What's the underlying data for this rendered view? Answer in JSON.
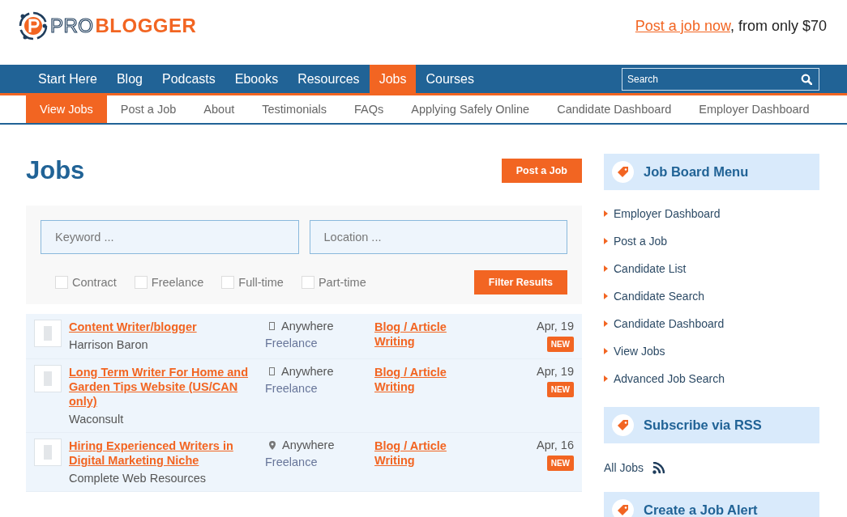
{
  "logo": {
    "prefix": "PRO",
    "suffix": "BLOGGER"
  },
  "promo": {
    "link": "Post a job now",
    "text": ", from only $70"
  },
  "nav": [
    {
      "label": "Start Here",
      "selected": false
    },
    {
      "label": "Blog",
      "selected": false
    },
    {
      "label": "Podcasts",
      "selected": false
    },
    {
      "label": "Ebooks",
      "selected": false
    },
    {
      "label": "Resources",
      "selected": false
    },
    {
      "label": "Jobs",
      "selected": true
    },
    {
      "label": "Courses",
      "selected": false
    }
  ],
  "search": {
    "placeholder": "Search"
  },
  "subnav": [
    {
      "label": "View Jobs",
      "selected": true
    },
    {
      "label": "Post a Job",
      "selected": false
    },
    {
      "label": "About",
      "selected": false
    },
    {
      "label": "Testimonials",
      "selected": false
    },
    {
      "label": "FAQs",
      "selected": false
    },
    {
      "label": "Applying Safely Online",
      "selected": false
    },
    {
      "label": "Candidate Dashboard",
      "selected": false
    },
    {
      "label": "Employer Dashboard",
      "selected": false
    }
  ],
  "page_title": "Jobs",
  "post_button": "Post a Job",
  "filters": {
    "keyword_placeholder": "Keyword ...",
    "location_placeholder": "Location ...",
    "types": [
      {
        "label": "Contract",
        "checked": false
      },
      {
        "label": "Freelance",
        "checked": false
      },
      {
        "label": "Full-time",
        "checked": false
      },
      {
        "label": "Part-time",
        "checked": false
      }
    ],
    "button": "Filter Results"
  },
  "jobs": [
    {
      "title": "Content Writer/blogger",
      "company": "Harrison Baron",
      "location": "Anywhere",
      "kind": "box",
      "type": "Freelance",
      "category": "Blog / Article Writing",
      "date": "Apr, 19",
      "badge": "NEW"
    },
    {
      "title": "Long Term Writer For Home and Garden Tips Website (US/CAN only)",
      "company": "Waconsult",
      "location": "Anywhere",
      "kind": "box",
      "type": "Freelance",
      "category": "Blog / Article Writing",
      "date": "Apr, 19",
      "badge": "NEW"
    },
    {
      "title": "Hiring Experienced Writers in Digital Marketing Niche",
      "company": "Complete Web Resources",
      "location": "Anywhere",
      "kind": "pin",
      "type": "Freelance",
      "category": "Blog / Article Writing",
      "date": "Apr, 16",
      "badge": "NEW"
    }
  ],
  "sidebar": {
    "menu_title": "Job Board Menu",
    "menu_items": [
      "Employer Dashboard",
      "Post a Job",
      "Candidate List",
      "Candidate Search",
      "Candidate Dashboard",
      "View Jobs",
      "Advanced Job Search"
    ],
    "rss_title": "Subscribe via RSS",
    "rss_link": "All Jobs",
    "alert_title": "Create a Job Alert"
  }
}
